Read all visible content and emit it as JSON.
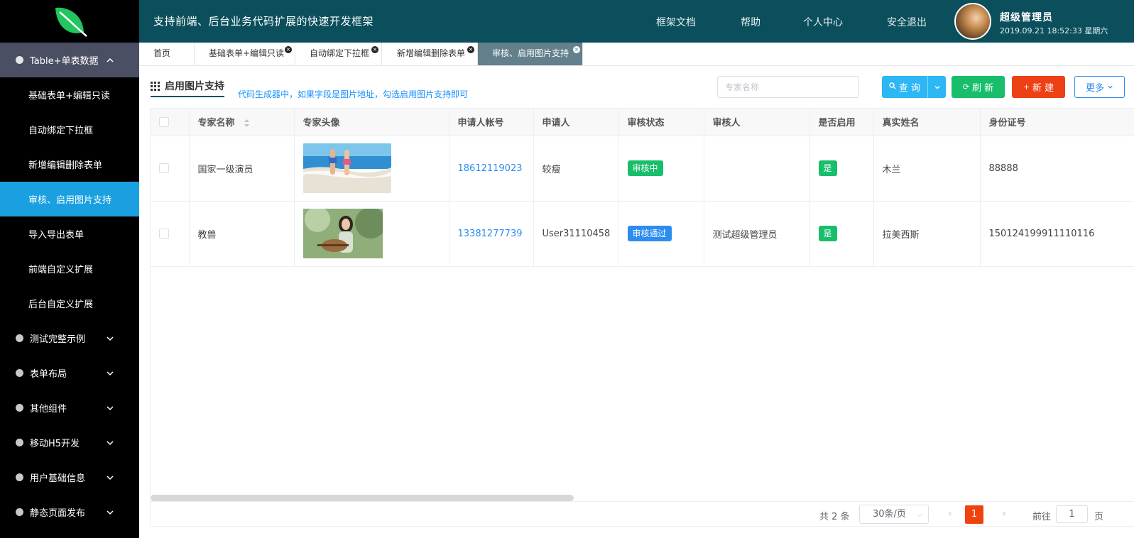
{
  "header": {
    "slogan": "支持前端、后台业务代码扩展的快速开发框架",
    "nav": [
      "框架文档",
      "帮助",
      "个人中心",
      "安全退出"
    ],
    "user_name": "超级管理员",
    "datetime": "2019.09.21 18:52:33 星期六"
  },
  "sidebar": {
    "open_group": "Table+单表数据",
    "items": [
      "基础表单+编辑只读",
      "自动绑定下拉框",
      "新增编辑删除表单",
      "审核、启用图片支持",
      "导入导出表单",
      "前端自定义扩展",
      "后台自定义扩展"
    ],
    "active_item": "审核、启用图片支持",
    "groups": [
      "测试完整示例",
      "表单布局",
      "其他组件",
      "移动H5开发",
      "用户基础信息",
      "静态页面发布"
    ]
  },
  "tabs": [
    {
      "label": "首页",
      "closable": false
    },
    {
      "label": "基础表单+编辑只读",
      "closable": true
    },
    {
      "label": "自动绑定下拉框",
      "closable": true
    },
    {
      "label": "新增编辑删除表单",
      "closable": true
    },
    {
      "label": "审核、启用图片支持",
      "closable": true,
      "active": true
    }
  ],
  "toolbar": {
    "title": "启用图片支持",
    "hint": "代码生成器中，如果字段是图片地址，勾选启用图片支持即可",
    "search_placeholder": "专家名称",
    "query_label": "查 询",
    "refresh_label": "刷 新",
    "new_label": "新 建",
    "more_label": "更多"
  },
  "table": {
    "columns": [
      "专家名称",
      "专家头像",
      "申请人帐号",
      "申请人",
      "审核状态",
      "审核人",
      "是否启用",
      "真实姓名",
      "身份证号"
    ],
    "rows": [
      {
        "name": "国家一级演员",
        "avatar": "beach-photo",
        "account": "18612119023",
        "applicant": "较瘦",
        "status": "审核中",
        "status_color": "#19be6b",
        "auditor": "",
        "enabled": "是",
        "real_name": "木兰",
        "id_number": "88888"
      },
      {
        "name": "教兽",
        "avatar": "guitar-girl-photo",
        "account": "13381277739",
        "applicant": "User31110458",
        "status": "审核通过",
        "status_color": "#2d8cf0",
        "auditor": "测试超级管理员",
        "enabled": "是",
        "real_name": "拉美西斯",
        "id_number": "150124199911110116"
      }
    ]
  },
  "pagination": {
    "total_text": "共 2 条",
    "page_size": "30条/页",
    "current_page": "1",
    "goto_label": "前往",
    "goto_value": "1",
    "page_unit": "页"
  },
  "colors": {
    "header_bg": "#0b4f5c",
    "sidebar_bg": "#000000",
    "active_menu": "#1aa0e0",
    "active_tab": "#64808c",
    "accent_red": "#ed4014"
  }
}
